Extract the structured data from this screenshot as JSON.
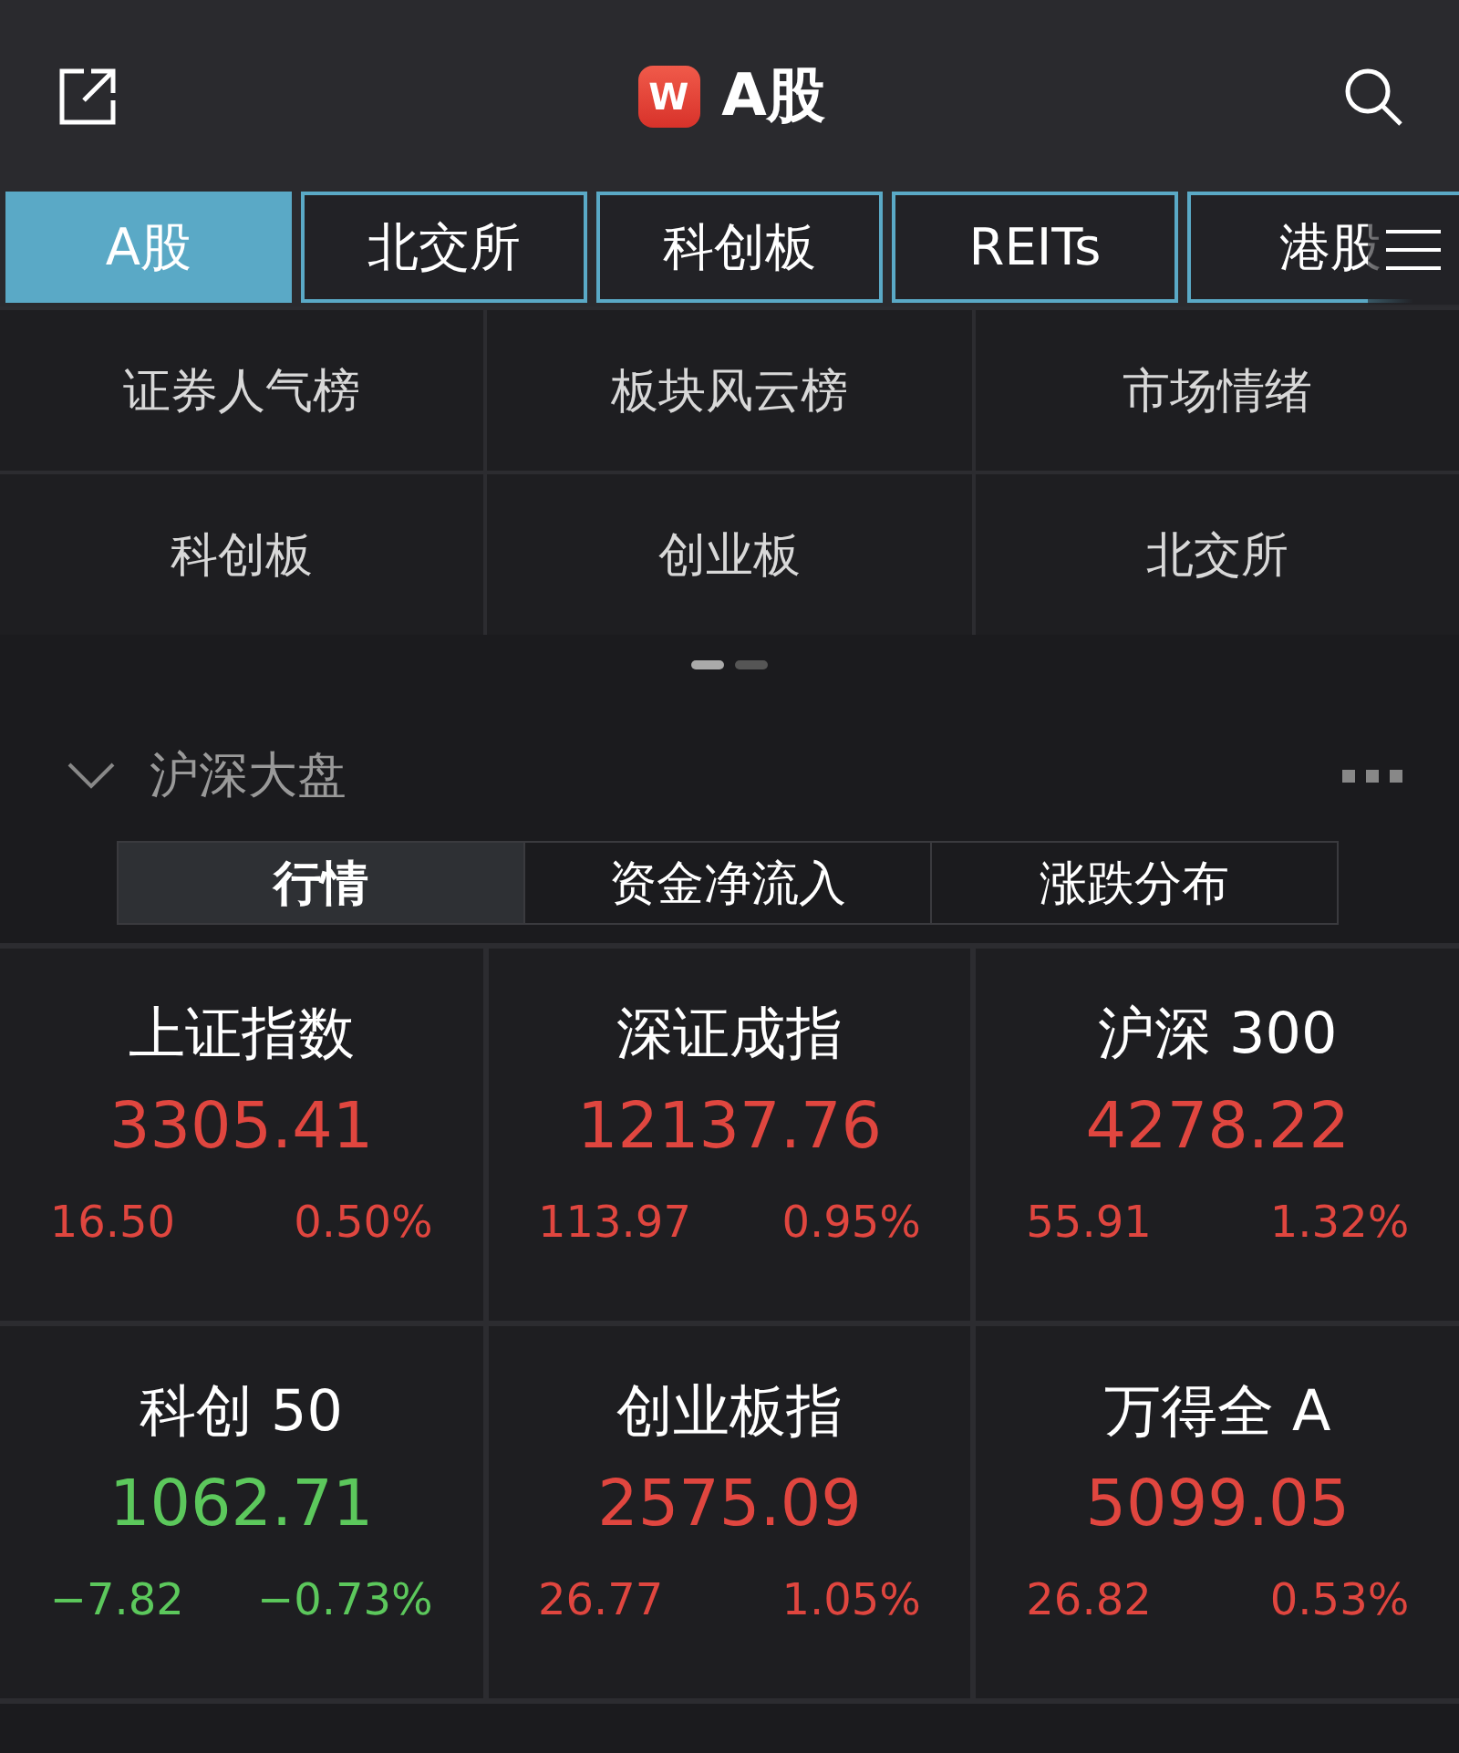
{
  "header": {
    "logo": "W",
    "title": "A股"
  },
  "tabs": [
    {
      "label": "A股",
      "selected": true
    },
    {
      "label": "北交所",
      "selected": false
    },
    {
      "label": "科创板",
      "selected": false
    },
    {
      "label": "REITs",
      "selected": false
    },
    {
      "label": "港股",
      "selected": false
    }
  ],
  "shortcuts": [
    "证券人气榜",
    "板块风云榜",
    "市场情绪",
    "科创板",
    "创业板",
    "北交所"
  ],
  "pager": [
    {
      "selected": true
    },
    {
      "selected": false
    }
  ],
  "section": {
    "title": "沪深大盘",
    "expanded": true,
    "segments": [
      {
        "label": "行情",
        "selected": true
      },
      {
        "label": "资金净流入",
        "selected": false
      },
      {
        "label": "涨跌分布",
        "selected": false
      }
    ]
  },
  "indices": [
    {
      "name": "上证指数",
      "price": "3305.41",
      "change": "16.50",
      "percent": "0.50%",
      "kind": "up"
    },
    {
      "name": "深证成指",
      "price": "12137.76",
      "change": "113.97",
      "percent": "0.95%",
      "kind": "up"
    },
    {
      "name": "沪深 300",
      "price": "4278.22",
      "change": "55.91",
      "percent": "1.32%",
      "kind": "up"
    },
    {
      "name": "科创 50",
      "price": "1062.71",
      "change": "−7.82",
      "percent": "−0.73%",
      "kind": "down"
    },
    {
      "name": "创业板指",
      "price": "2575.09",
      "change": "26.77",
      "percent": "1.05%",
      "kind": "up"
    },
    {
      "name": "万得全 A",
      "price": "5099.05",
      "change": "26.82",
      "percent": "0.53%",
      "kind": "up"
    }
  ]
}
